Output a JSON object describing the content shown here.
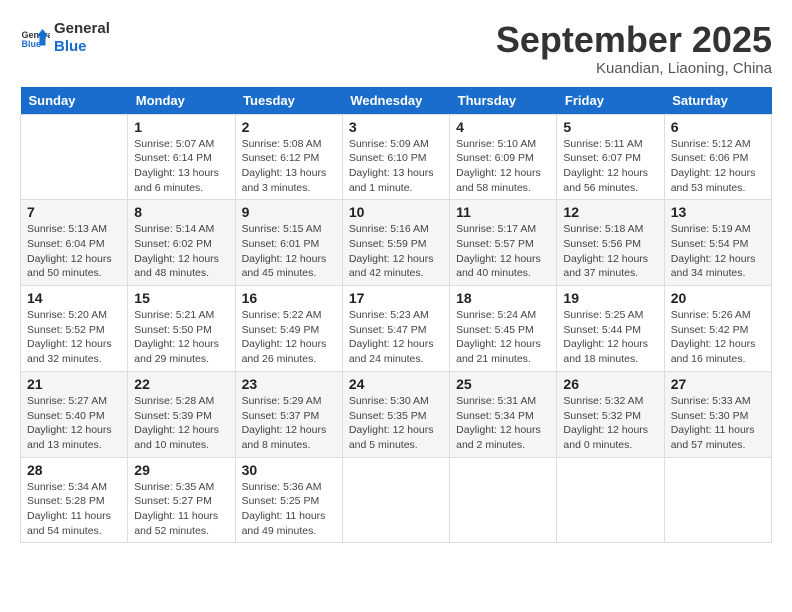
{
  "logo": {
    "line1": "General",
    "line2": "Blue"
  },
  "title": "September 2025",
  "subtitle": "Kuandian, Liaoning, China",
  "days_of_week": [
    "Sunday",
    "Monday",
    "Tuesday",
    "Wednesday",
    "Thursday",
    "Friday",
    "Saturday"
  ],
  "weeks": [
    [
      {
        "num": "",
        "info": ""
      },
      {
        "num": "1",
        "info": "Sunrise: 5:07 AM\nSunset: 6:14 PM\nDaylight: 13 hours\nand 6 minutes."
      },
      {
        "num": "2",
        "info": "Sunrise: 5:08 AM\nSunset: 6:12 PM\nDaylight: 13 hours\nand 3 minutes."
      },
      {
        "num": "3",
        "info": "Sunrise: 5:09 AM\nSunset: 6:10 PM\nDaylight: 13 hours\nand 1 minute."
      },
      {
        "num": "4",
        "info": "Sunrise: 5:10 AM\nSunset: 6:09 PM\nDaylight: 12 hours\nand 58 minutes."
      },
      {
        "num": "5",
        "info": "Sunrise: 5:11 AM\nSunset: 6:07 PM\nDaylight: 12 hours\nand 56 minutes."
      },
      {
        "num": "6",
        "info": "Sunrise: 5:12 AM\nSunset: 6:06 PM\nDaylight: 12 hours\nand 53 minutes."
      }
    ],
    [
      {
        "num": "7",
        "info": "Sunrise: 5:13 AM\nSunset: 6:04 PM\nDaylight: 12 hours\nand 50 minutes."
      },
      {
        "num": "8",
        "info": "Sunrise: 5:14 AM\nSunset: 6:02 PM\nDaylight: 12 hours\nand 48 minutes."
      },
      {
        "num": "9",
        "info": "Sunrise: 5:15 AM\nSunset: 6:01 PM\nDaylight: 12 hours\nand 45 minutes."
      },
      {
        "num": "10",
        "info": "Sunrise: 5:16 AM\nSunset: 5:59 PM\nDaylight: 12 hours\nand 42 minutes."
      },
      {
        "num": "11",
        "info": "Sunrise: 5:17 AM\nSunset: 5:57 PM\nDaylight: 12 hours\nand 40 minutes."
      },
      {
        "num": "12",
        "info": "Sunrise: 5:18 AM\nSunset: 5:56 PM\nDaylight: 12 hours\nand 37 minutes."
      },
      {
        "num": "13",
        "info": "Sunrise: 5:19 AM\nSunset: 5:54 PM\nDaylight: 12 hours\nand 34 minutes."
      }
    ],
    [
      {
        "num": "14",
        "info": "Sunrise: 5:20 AM\nSunset: 5:52 PM\nDaylight: 12 hours\nand 32 minutes."
      },
      {
        "num": "15",
        "info": "Sunrise: 5:21 AM\nSunset: 5:50 PM\nDaylight: 12 hours\nand 29 minutes."
      },
      {
        "num": "16",
        "info": "Sunrise: 5:22 AM\nSunset: 5:49 PM\nDaylight: 12 hours\nand 26 minutes."
      },
      {
        "num": "17",
        "info": "Sunrise: 5:23 AM\nSunset: 5:47 PM\nDaylight: 12 hours\nand 24 minutes."
      },
      {
        "num": "18",
        "info": "Sunrise: 5:24 AM\nSunset: 5:45 PM\nDaylight: 12 hours\nand 21 minutes."
      },
      {
        "num": "19",
        "info": "Sunrise: 5:25 AM\nSunset: 5:44 PM\nDaylight: 12 hours\nand 18 minutes."
      },
      {
        "num": "20",
        "info": "Sunrise: 5:26 AM\nSunset: 5:42 PM\nDaylight: 12 hours\nand 16 minutes."
      }
    ],
    [
      {
        "num": "21",
        "info": "Sunrise: 5:27 AM\nSunset: 5:40 PM\nDaylight: 12 hours\nand 13 minutes."
      },
      {
        "num": "22",
        "info": "Sunrise: 5:28 AM\nSunset: 5:39 PM\nDaylight: 12 hours\nand 10 minutes."
      },
      {
        "num": "23",
        "info": "Sunrise: 5:29 AM\nSunset: 5:37 PM\nDaylight: 12 hours\nand 8 minutes."
      },
      {
        "num": "24",
        "info": "Sunrise: 5:30 AM\nSunset: 5:35 PM\nDaylight: 12 hours\nand 5 minutes."
      },
      {
        "num": "25",
        "info": "Sunrise: 5:31 AM\nSunset: 5:34 PM\nDaylight: 12 hours\nand 2 minutes."
      },
      {
        "num": "26",
        "info": "Sunrise: 5:32 AM\nSunset: 5:32 PM\nDaylight: 12 hours\nand 0 minutes."
      },
      {
        "num": "27",
        "info": "Sunrise: 5:33 AM\nSunset: 5:30 PM\nDaylight: 11 hours\nand 57 minutes."
      }
    ],
    [
      {
        "num": "28",
        "info": "Sunrise: 5:34 AM\nSunset: 5:28 PM\nDaylight: 11 hours\nand 54 minutes."
      },
      {
        "num": "29",
        "info": "Sunrise: 5:35 AM\nSunset: 5:27 PM\nDaylight: 11 hours\nand 52 minutes."
      },
      {
        "num": "30",
        "info": "Sunrise: 5:36 AM\nSunset: 5:25 PM\nDaylight: 11 hours\nand 49 minutes."
      },
      {
        "num": "",
        "info": ""
      },
      {
        "num": "",
        "info": ""
      },
      {
        "num": "",
        "info": ""
      },
      {
        "num": "",
        "info": ""
      }
    ]
  ]
}
